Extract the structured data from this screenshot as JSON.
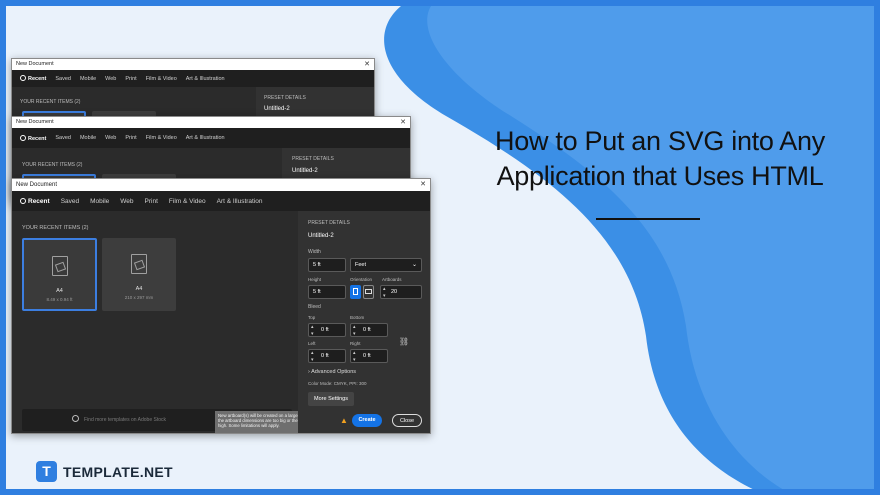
{
  "headline": {
    "line1": "How to Put an SVG into Any",
    "line2": "Application that Uses HTML"
  },
  "brand": {
    "mark": "T",
    "name": "TEMPLATE.NET"
  },
  "colors": {
    "accent": "#2f7fe0",
    "dialog_bg": "#2b2b2b",
    "create_button": "#1473e6"
  },
  "dialog": {
    "title": "New Document",
    "close": "✕",
    "tabs": [
      "Recent",
      "Saved",
      "Mobile",
      "Web",
      "Print",
      "Film & Video",
      "Art & Illustration"
    ],
    "recent_label": "YOUR RECENT ITEMS",
    "recent_count": "(2)",
    "recent_items": [
      {
        "name": "A4",
        "size": "8.49 x 0.94 ft"
      },
      {
        "name": "A4",
        "size": "210 x 297 mm"
      }
    ],
    "preset_details_label": "PRESET DETAILS",
    "preset_name": "Untitled-2",
    "width_label": "Width",
    "width_value": "5 ft",
    "unit": "Feet",
    "height_label": "Height",
    "height_value": "5 ft",
    "orientation_label": "Orientation",
    "artboards_label": "Artboards",
    "artboards_value": "20",
    "bleed_label": "Bleed",
    "top_label": "Top",
    "top_value": "0 ft",
    "bottom_label": "Bottom",
    "bottom_value": "0 ft",
    "left_label": "Left",
    "left_value": "0 ft",
    "right_label": "Right",
    "right_value": "0 ft",
    "advanced_options": "Advanced Options",
    "color_mode": "Color Mode: CMYK, PPI: 300",
    "more_settings": "More Settings",
    "search_placeholder": "Find more templates on Adobe Stock",
    "tooltip": "New artboard(s) will be created on a large super canvas as the artboard dimensions are too big or the artboard count is high. Some limitations will apply.",
    "create": "Create",
    "close_button": "Close"
  }
}
